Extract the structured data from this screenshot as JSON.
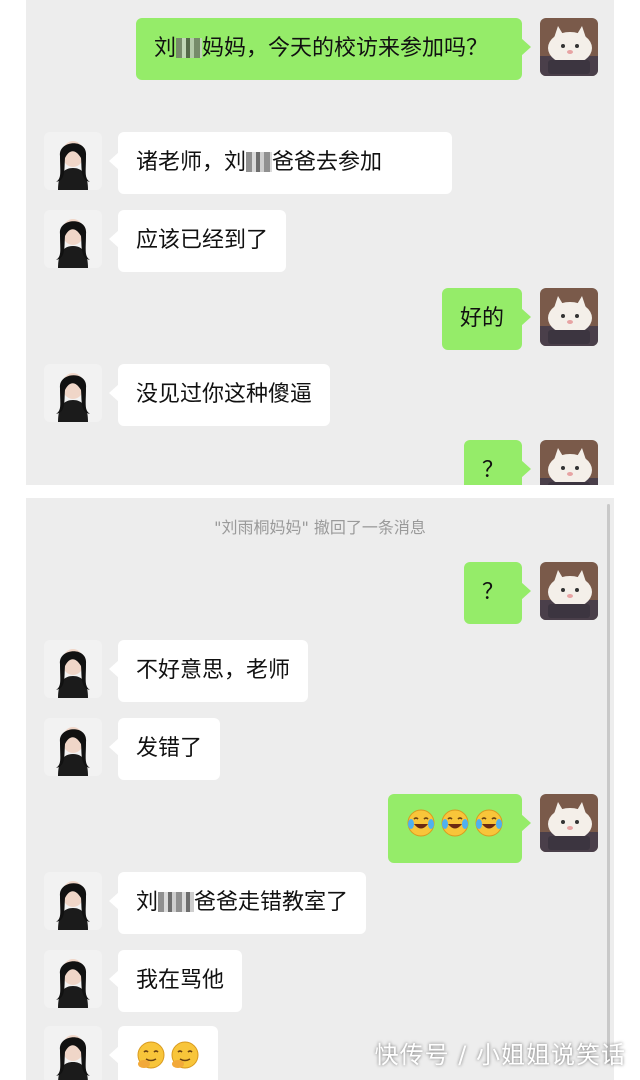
{
  "top_panel": {
    "messages": [
      {
        "side": "right",
        "parts": [
          "刘",
          "[redacted]",
          "妈妈，今天的校访来参加吗？"
        ]
      },
      {
        "side": "left",
        "parts": [
          "诸老师，刘",
          "[redacted]",
          "爸爸去参加"
        ]
      },
      {
        "side": "left",
        "text": "应该已经到了"
      },
      {
        "side": "right",
        "text": "好的"
      },
      {
        "side": "left",
        "text": "没见过你这种傻逼"
      },
      {
        "side": "right",
        "text": "？"
      }
    ]
  },
  "bottom_panel": {
    "recall_notice": "\"刘雨桐妈妈\" 撤回了一条消息",
    "messages": [
      {
        "side": "right",
        "text": "？"
      },
      {
        "side": "left",
        "text": "不好意思，老师"
      },
      {
        "side": "left",
        "text": "发错了"
      },
      {
        "side": "right",
        "emojis": [
          "laughing-crying-emoji",
          "laughing-crying-emoji",
          "laughing-crying-emoji"
        ]
      },
      {
        "side": "left",
        "parts": [
          "刘",
          "[redacted]",
          "爸爸走错教室了"
        ]
      },
      {
        "side": "left",
        "text": "我在骂他"
      },
      {
        "side": "left",
        "emojis": [
          "shy-smile-emoji",
          "shy-smile-emoji"
        ]
      }
    ]
  },
  "watermark": "快传号 / 小姐姐说笑话",
  "colors": {
    "chat_background": "#ededed",
    "sent_bubble": "#95ec69",
    "received_bubble": "#ffffff"
  }
}
